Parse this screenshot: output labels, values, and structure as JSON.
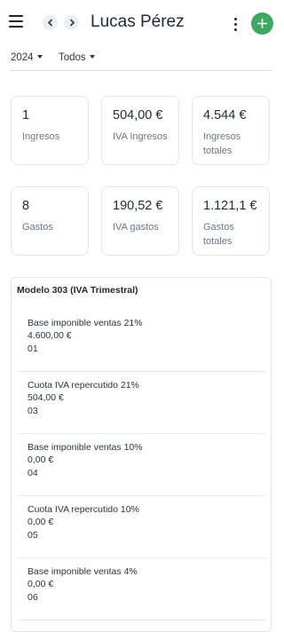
{
  "header": {
    "title": "Lucas Pérez",
    "menu_icon": "hamburger-menu-icon",
    "back_icon": "chevron-left-icon",
    "forward_icon": "chevron-right-icon",
    "more_icon": "more-vertical-icon",
    "add_icon": "plus-icon"
  },
  "filters": {
    "year": "2024",
    "type": "Todos"
  },
  "cards": [
    {
      "value": "1",
      "label": "Ingresos"
    },
    {
      "value": "504,00 €",
      "label": "IVA Ingresos"
    },
    {
      "value": "4.544 €",
      "label": "Ingresos totales"
    },
    {
      "value": "8",
      "label": "Gastos"
    },
    {
      "value": "190,52 €",
      "label": "IVA gastos"
    },
    {
      "value": "1.121,1 €",
      "label": "Gastos totales"
    }
  ],
  "modelo": {
    "title": "Modelo 303 (IVA Trimestral)",
    "rows": [
      {
        "name": "Base imponible ventas 21%",
        "amount": "4.600,00 €",
        "code": "01"
      },
      {
        "name": "Cuota IVA repercutido 21%",
        "amount": "504,00 €",
        "code": "03"
      },
      {
        "name": "Base imponible ventas 10%",
        "amount": "0,00 €",
        "code": "04"
      },
      {
        "name": "Cuota IVA repercutido 10%",
        "amount": "0,00 €",
        "code": "05"
      },
      {
        "name": "Base imponible ventas 4%",
        "amount": "0,00 €",
        "code": "06"
      }
    ]
  },
  "colors": {
    "accent_green": "#3ca860",
    "label_gray": "#6c7685",
    "card_border": "#e2e5ea"
  }
}
